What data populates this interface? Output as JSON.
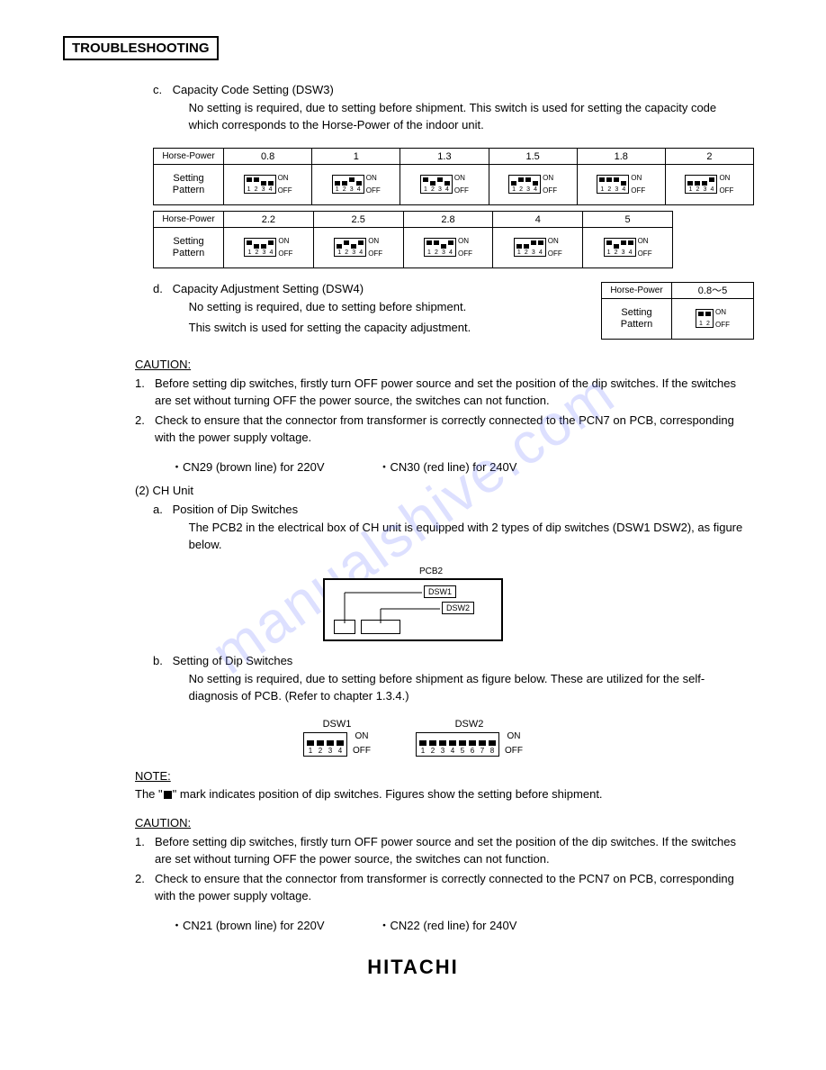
{
  "page_title": "TROUBLESHOOTING",
  "watermark": "manualshive.com",
  "section_c": {
    "letter": "c.",
    "title": "Capacity Code Setting (DSW3)",
    "desc": "No setting is required, due to setting before shipment.  This switch is used for setting the capacity code which corresponds to the Horse-Power of the indoor unit."
  },
  "dip_row1": {
    "left_head": "Horse-Power",
    "left_body": "Setting\nPattern",
    "heads": [
      "0.8",
      "1",
      "1.3",
      "1.5",
      "1.8",
      "2"
    ],
    "patterns": [
      [
        1,
        1,
        0,
        0
      ],
      [
        0,
        0,
        1,
        0
      ],
      [
        1,
        0,
        1,
        0
      ],
      [
        0,
        1,
        1,
        0
      ],
      [
        1,
        1,
        1,
        0
      ],
      [
        0,
        0,
        0,
        1
      ]
    ],
    "on": "ON",
    "off": "OFF",
    "nums4": [
      "1",
      "2",
      "3",
      "4"
    ]
  },
  "dip_row2": {
    "left_head": "Horse-Power",
    "left_body": "Setting\nPattern",
    "heads": [
      "2.2",
      "2.5",
      "2.8",
      "4",
      "5"
    ],
    "patterns": [
      [
        1,
        0,
        0,
        1
      ],
      [
        0,
        1,
        0,
        1
      ],
      [
        1,
        1,
        0,
        1
      ],
      [
        0,
        0,
        1,
        1
      ],
      [
        1,
        0,
        1,
        1
      ]
    ],
    "on": "ON",
    "off": "OFF",
    "nums4": [
      "1",
      "2",
      "3",
      "4"
    ]
  },
  "section_d": {
    "letter": "d.",
    "title": "Capacity Adjustment Setting (DSW4)",
    "l1": "No setting is required, due to setting before shipment.",
    "l2": "This switch is used for setting the capacity adjustment."
  },
  "dsw4_table": {
    "head_left": "Horse-Power",
    "head_right": "0.8～5",
    "body_left": "Setting\nPattern",
    "pattern": [
      1,
      1
    ],
    "on": "ON",
    "off": "OFF",
    "nums2": [
      "1",
      "2"
    ]
  },
  "caution1": {
    "head": "CAUTION:",
    "items": [
      "Before setting dip switches, firstly turn OFF power source and set the position of the dip switches. If the switches are set without turning OFF the power source, the switches can not function.",
      "Check to ensure that the connector from transformer is correctly connected to the PCN7 on PCB, corresponding with the power supply voltage."
    ],
    "conn_a": "・CN29 (brown line) for 220V",
    "conn_b": "・CN30 (red line) for 240V"
  },
  "sec2": {
    "head": "(2)  CH Unit",
    "a_letter": "a.",
    "a_title": "Position of Dip Switches",
    "a_desc": "The PCB2 in the electrical box of CH unit is equipped with 2 types of dip switches (DSW1 DSW2), as figure below.",
    "pcb2_label": "PCB2",
    "dsw1_label": "DSW1",
    "dsw2_label": "DSW2",
    "b_letter": "b.",
    "b_title": "Setting of Dip Switches",
    "b_desc": "No setting is required, due to setting before shipment as figure below.  These are utilized for the self-diagnosis of PCB.  (Refer to chapter 1.3.4.)"
  },
  "dsw_figs": {
    "dsw1": {
      "label": "DSW1",
      "pattern": [
        0,
        0,
        0,
        0
      ],
      "nums": [
        "1",
        "2",
        "3",
        "4"
      ],
      "on": "ON",
      "off": "OFF"
    },
    "dsw2": {
      "label": "DSW2",
      "pattern": [
        0,
        0,
        0,
        0,
        0,
        0,
        0,
        0
      ],
      "nums": [
        "1",
        "2",
        "3",
        "4",
        "5",
        "6",
        "7",
        "8"
      ],
      "on": "ON",
      "off": "OFF"
    }
  },
  "note": {
    "head": "NOTE:",
    "text_a": "The \"",
    "text_b": "\" mark indicates position of dip switches.  Figures show the setting before shipment."
  },
  "caution2": {
    "head": "CAUTION:",
    "items": [
      "Before setting dip switches, firstly turn OFF power source and set the position of the dip switches. If the switches are set without turning OFF the power source, the switches can not function.",
      "Check to ensure that the connector from transformer is correctly connected to the PCN7 on PCB, corresponding with the power supply voltage."
    ],
    "conn_a": "・CN21 (brown line) for 220V",
    "conn_b": "・CN22 (red line) for 240V"
  },
  "brand": "HITACHI"
}
